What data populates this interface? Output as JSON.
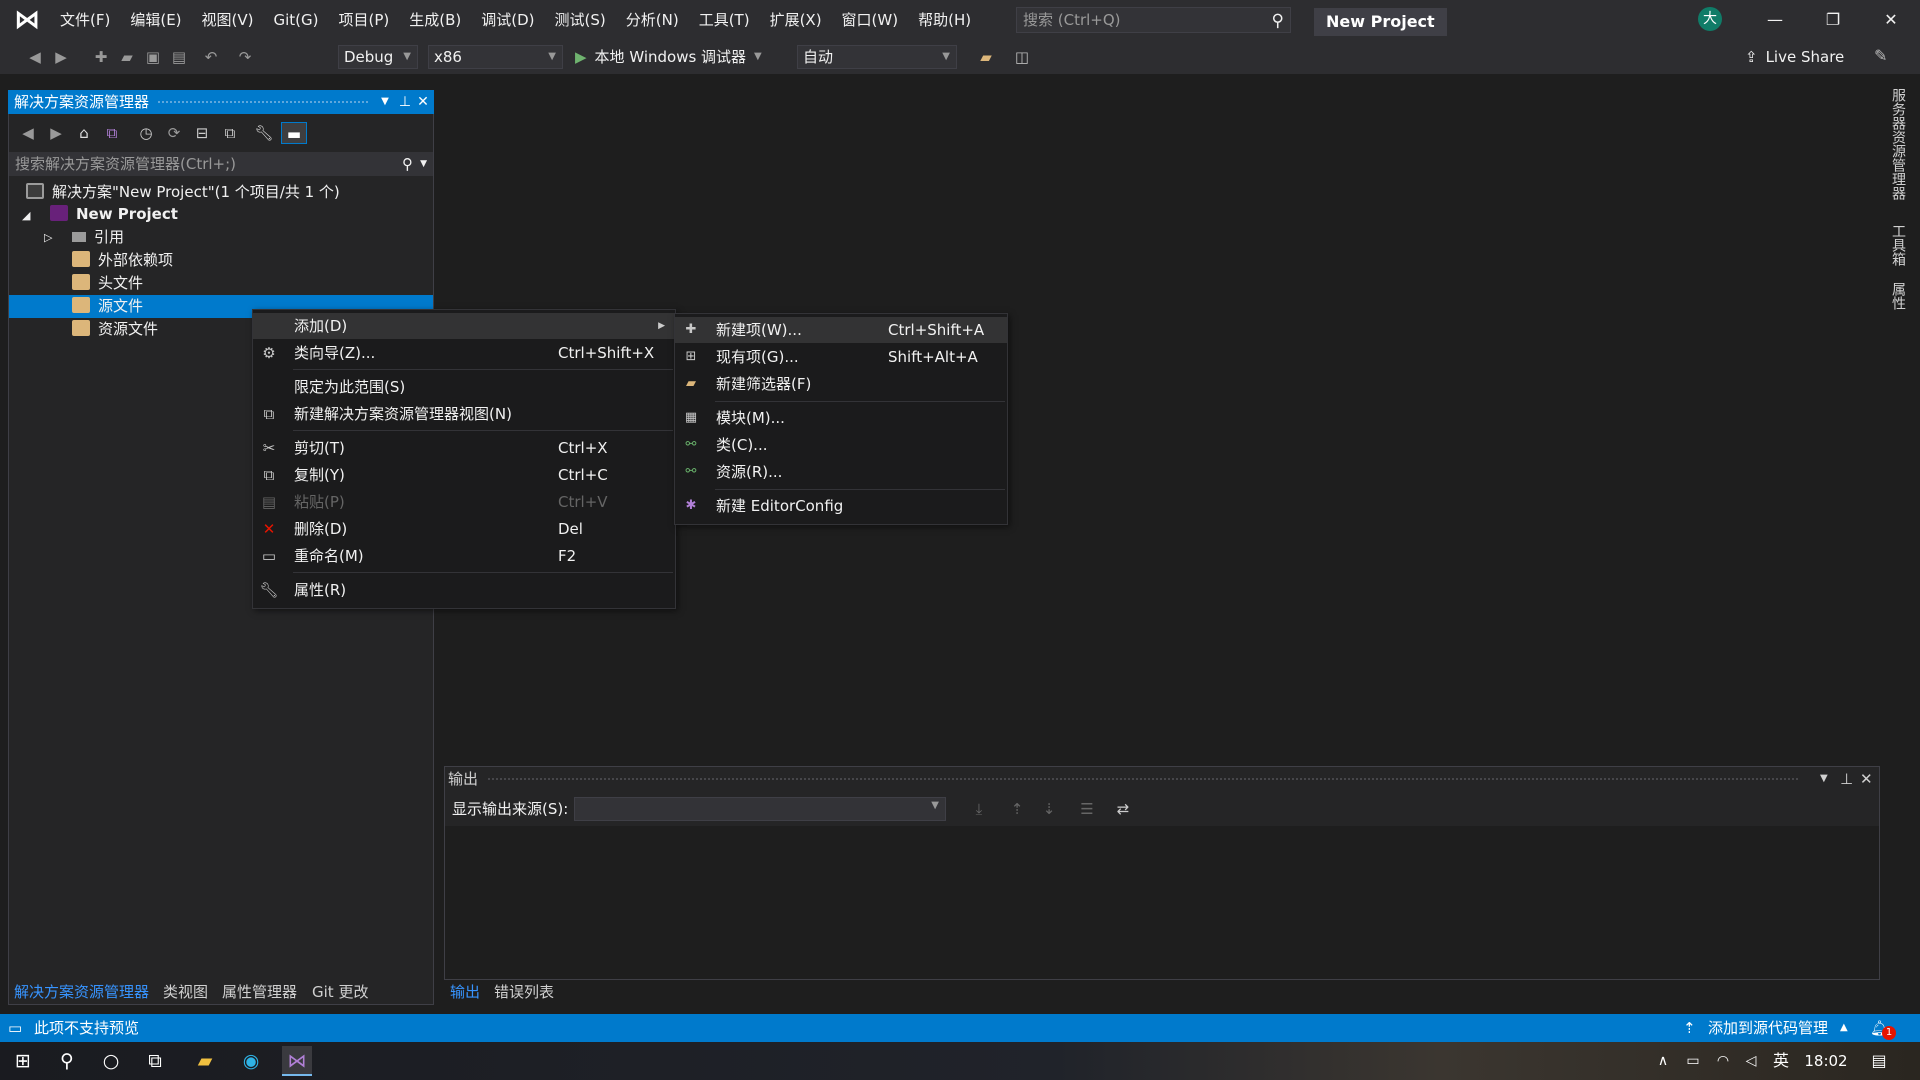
{
  "titlebar": {
    "menu": [
      "文件(F)",
      "编辑(E)",
      "视图(V)",
      "Git(G)",
      "项目(P)",
      "生成(B)",
      "调试(D)",
      "测试(S)",
      "分析(N)",
      "工具(T)",
      "扩展(X)",
      "窗口(W)",
      "帮助(H)"
    ],
    "search_placeholder": "搜索 (Ctrl+Q)",
    "project_name": "New Project",
    "avatar_initial": "大",
    "minimize": "—",
    "restore": "❐",
    "close": "✕"
  },
  "toolbar": {
    "config": "Debug",
    "platform": "x86",
    "run_label": "本地 Windows 调试器",
    "auto_label": "自动",
    "live_share": "Live Share"
  },
  "solution_explorer": {
    "title": "解决方案资源管理器",
    "search_placeholder": "搜索解决方案资源管理器(Ctrl+;)",
    "tree": {
      "solution": "解决方案\"New Project\"(1 个项目/共 1 个)",
      "project": "New Project",
      "references": "引用",
      "external_deps": "外部依赖项",
      "header_files": "头文件",
      "source_files": "源文件",
      "resource_files": "资源文件"
    },
    "tabs": [
      "解决方案资源管理器",
      "类视图",
      "属性管理器",
      "Git 更改"
    ]
  },
  "context_menu": {
    "add": "添加(D)",
    "class_wizard": "类向导(Z)...",
    "class_wizard_sc": "Ctrl+Shift+X",
    "scope": "限定为此范围(S)",
    "new_view": "新建解决方案资源管理器视图(N)",
    "cut": "剪切(T)",
    "cut_sc": "Ctrl+X",
    "copy": "复制(Y)",
    "copy_sc": "Ctrl+C",
    "paste": "粘贴(P)",
    "paste_sc": "Ctrl+V",
    "delete": "删除(D)",
    "delete_sc": "Del",
    "rename": "重命名(M)",
    "rename_sc": "F2",
    "properties": "属性(R)"
  },
  "submenu": {
    "new_item": "新建项(W)...",
    "new_item_sc": "Ctrl+Shift+A",
    "existing_item": "现有项(G)...",
    "existing_item_sc": "Shift+Alt+A",
    "new_filter": "新建筛选器(F)",
    "module": "模块(M)...",
    "class": "类(C)...",
    "resource": "资源(R)...",
    "editorconfig": "新建 EditorConfig"
  },
  "output": {
    "title": "输出",
    "source_label": "显示输出来源(S):",
    "tabs": [
      "输出",
      "错误列表"
    ]
  },
  "right_tabs": [
    "服务器资源管理器",
    "工具箱",
    "属性"
  ],
  "statusbar": {
    "message": "此项不支持预览",
    "source_control": "添加到源代码管理",
    "notification_count": "1"
  },
  "taskbar": {
    "ime": "英",
    "time": "18:02"
  },
  "colors": {
    "accent": "#007acc",
    "background": "#1e1e1e",
    "panel": "#252526",
    "delete_red": "#e51400"
  }
}
